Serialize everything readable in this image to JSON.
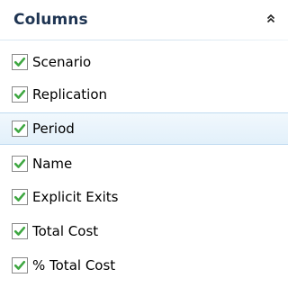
{
  "panel": {
    "title": "Columns",
    "collapse_icon": "double-chevron-up-icon",
    "check_color": "#3fa742",
    "items": [
      {
        "label": "Scenario",
        "checked": true,
        "selected": false
      },
      {
        "label": "Replication",
        "checked": true,
        "selected": false
      },
      {
        "label": "Period",
        "checked": true,
        "selected": true
      },
      {
        "label": "Name",
        "checked": true,
        "selected": false
      },
      {
        "label": "Explicit Exits",
        "checked": true,
        "selected": false
      },
      {
        "label": "Total Cost",
        "checked": true,
        "selected": false
      },
      {
        "label": "% Total Cost",
        "checked": true,
        "selected": false
      }
    ]
  }
}
